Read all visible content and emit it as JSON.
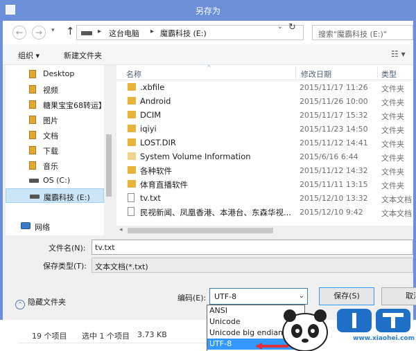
{
  "window": {
    "title": "另存为"
  },
  "nav": {
    "back_icon": "←",
    "forward_icon": "→",
    "recent_icon": "▾",
    "up_icon": "↑"
  },
  "address": {
    "separator": "▸",
    "crumbs": [
      "这台电脑",
      "魔霸科技 (E:)"
    ],
    "dropdown_icon": "⌄",
    "refresh_icon": "↻"
  },
  "search": {
    "placeholder": "搜索\"魔霸科技 (E:)\""
  },
  "toolbar": {
    "organize_label": "组织 ▾",
    "new_folder_label": "新建文件夹",
    "view_icon": "☷ ▾"
  },
  "navpane": {
    "items": [
      {
        "label": "Desktop"
      },
      {
        "label": "视频"
      },
      {
        "label": "糖果宝宝68转运】"
      },
      {
        "label": "图片"
      },
      {
        "label": "文档"
      },
      {
        "label": "下载"
      },
      {
        "label": "音乐"
      },
      {
        "label": "OS (C:)"
      },
      {
        "label": "魔霸科技 (E:)"
      },
      {
        "label": "网络"
      }
    ]
  },
  "filelist": {
    "columns": {
      "name": "名称",
      "date": "修改日期",
      "type": "类型"
    },
    "sort_icon": "^",
    "rows": [
      {
        "name": ".xbfile",
        "date": "2015/11/17 11:26",
        "type": "文件夹"
      },
      {
        "name": "Android",
        "date": "2015/11/26 10:00",
        "type": "文件夹"
      },
      {
        "name": "DCIM",
        "date": "2015/11/17 15:32",
        "type": "文件夹"
      },
      {
        "name": "iqiyi",
        "date": "2015/11/23 14:50",
        "type": "文件夹"
      },
      {
        "name": "LOST.DIR",
        "date": "2015/11/12 14:41",
        "type": "文件夹"
      },
      {
        "name": "System Volume Information",
        "date": "2015/6/16 6:44",
        "type": "文件夹"
      },
      {
        "name": "各种软件",
        "date": "2015/11/12 14:32",
        "type": "文件夹"
      },
      {
        "name": "体育直播软件",
        "date": "2015/11/11 13:15",
        "type": "文件夹"
      },
      {
        "name": "tv.txt",
        "date": "2015/12/10 13:32",
        "type": "文本文档"
      },
      {
        "name": "民视新闻、凤凰香港、本港台、东森华视...",
        "date": "2015/12/10 9:42",
        "type": "文本文档"
      }
    ],
    "scroll_left_icon": "◂"
  },
  "filename": {
    "label": "文件名(N):",
    "value": "tv.txt"
  },
  "savetype": {
    "label": "保存类型(T):",
    "value": "文本文档(*.txt)"
  },
  "hide_folders": {
    "icon": "^",
    "label": "隐藏文件夹"
  },
  "encoding": {
    "label": "编码(E):",
    "value": "UTF-8",
    "dropdown_icon": "⌄",
    "options": [
      "ANSI",
      "Unicode",
      "Unicode big endian",
      "UTF-8"
    ]
  },
  "buttons": {
    "save": "保存(S)",
    "cancel": "取消"
  },
  "statusbar": {
    "item_count": "19 个项目",
    "selected": "选中 1 个项目",
    "size": "3.73 KB"
  },
  "watermark": {
    "url": "www.xiaohei.com"
  },
  "colors": {
    "titlebar": "#6b8fd8",
    "selection": "#3399ff",
    "nav_selected": "#cde6f7",
    "folder": "#e8b53a",
    "arrow": "#e0303a"
  }
}
